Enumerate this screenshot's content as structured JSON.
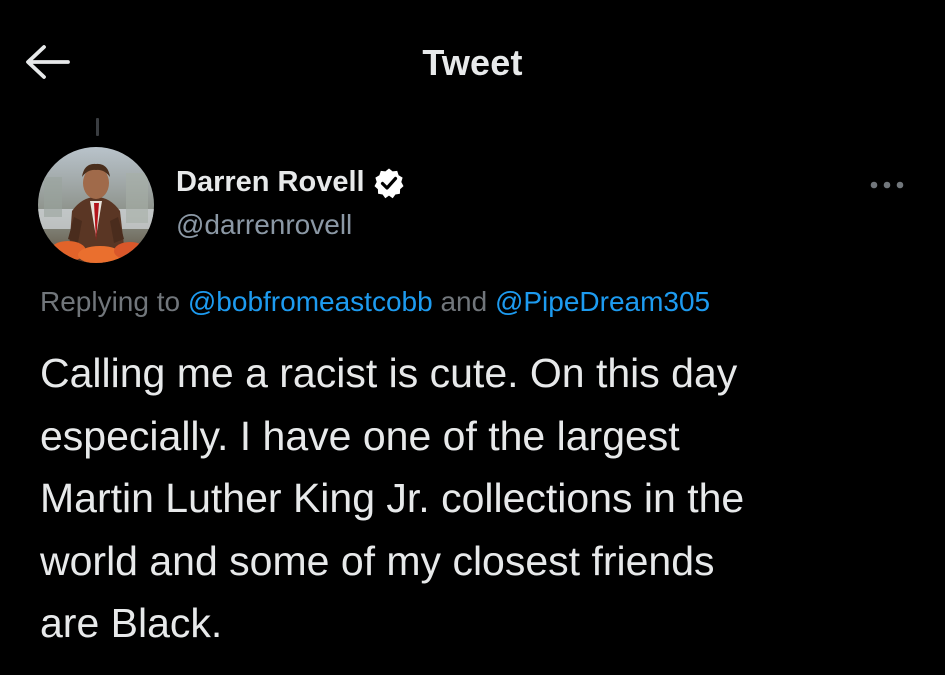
{
  "header": {
    "title": "Tweet",
    "back_icon": "arrow-left-icon"
  },
  "author": {
    "display_name": "Darren Rovell",
    "handle": "@darrenrovell",
    "verified": true,
    "verified_icon": "verified-badge-icon",
    "avatar_icon": "avatar-photo"
  },
  "reply_context": {
    "prefix": "Replying to",
    "mentions": [
      "@bobfromeastcobb",
      "@PipeDream305"
    ],
    "conjunction": "and"
  },
  "tweet": {
    "lines": [
      "Calling me a racist is cute. On this day",
      "especially. I have one of the largest",
      "Martin Luther King Jr. collections in the",
      "world and some of my closest friends",
      "are Black."
    ]
  },
  "more_icon": "more-horizontal-icon",
  "colors": {
    "background": "#000000",
    "text_primary": "#e7e9ea",
    "text_secondary": "#71767b",
    "accent": "#1d9bf0"
  }
}
